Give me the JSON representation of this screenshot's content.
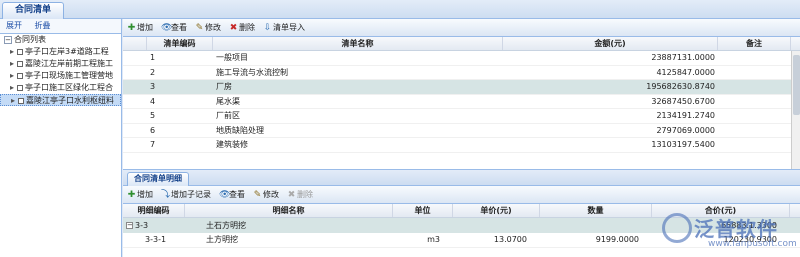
{
  "window": {
    "tab_title": "合同清单"
  },
  "left": {
    "expand_label": "展开",
    "collapse_label": "折叠",
    "root_label": "合同列表",
    "items": [
      "亭子口左岸3#道路工程",
      "嘉陵江左岸前期工程施工",
      "亭子口现场施工管理营地",
      "亭子口施工区绿化工程合",
      "嘉陵江亭子口水利枢纽料"
    ],
    "selected_index": 4
  },
  "top_toolbar": {
    "buttons": [
      {
        "label": "增加",
        "icon": "add-icon",
        "disabled": false
      },
      {
        "label": "查看",
        "icon": "view-icon",
        "disabled": false
      },
      {
        "label": "修改",
        "icon": "edit-icon",
        "disabled": false
      },
      {
        "label": "删除",
        "icon": "delete-icon",
        "disabled": false
      },
      {
        "label": "清单导入",
        "icon": "import-icon",
        "disabled": false
      }
    ]
  },
  "list_grid": {
    "headers": {
      "code": "清单编码",
      "name": "清单名称",
      "amount": "金额(元)",
      "note": "备注"
    },
    "rows": [
      {
        "code": "1",
        "name": "一般项目",
        "amount": "23887131.0000",
        "note": ""
      },
      {
        "code": "2",
        "name": "施工导流与水流控制",
        "amount": "4125847.0000",
        "note": ""
      },
      {
        "code": "3",
        "name": "厂房",
        "amount": "195682630.8740",
        "note": ""
      },
      {
        "code": "4",
        "name": "尾水渠",
        "amount": "32687450.6700",
        "note": ""
      },
      {
        "code": "5",
        "name": "厂前区",
        "amount": "2134191.2740",
        "note": ""
      },
      {
        "code": "6",
        "name": "地质缺陷处理",
        "amount": "2797069.0000",
        "note": ""
      },
      {
        "code": "7",
        "name": "建筑装修",
        "amount": "13103197.5400",
        "note": ""
      }
    ],
    "selected_index": 2
  },
  "detail": {
    "tab_title": "合同清单明细",
    "toolbar": {
      "buttons": [
        {
          "label": "增加",
          "icon": "add-icon",
          "disabled": false
        },
        {
          "label": "增加子记录",
          "icon": "add-child-icon",
          "disabled": false
        },
        {
          "label": "查看",
          "icon": "view-icon",
          "disabled": false
        },
        {
          "label": "修改",
          "icon": "edit-icon",
          "disabled": false
        },
        {
          "label": "删除",
          "icon": "delete-icon",
          "disabled": true
        }
      ]
    },
    "headers": {
      "code": "明细编码",
      "name": "明细名称",
      "unit": "单位",
      "price": "单价(元)",
      "qty": "数量",
      "total": "合价(元)"
    },
    "group": {
      "code": "3-3",
      "name": "土石方明挖",
      "total": "65883.1.3300"
    },
    "rows": [
      {
        "code": "3-3-1",
        "name": "土方明挖",
        "unit": "m3",
        "price": "13.0700",
        "qty": "9199.0000",
        "total": "120230.9300"
      }
    ]
  },
  "logo": {
    "name": "泛普软件",
    "url": "www.fanpusoft.com"
  }
}
